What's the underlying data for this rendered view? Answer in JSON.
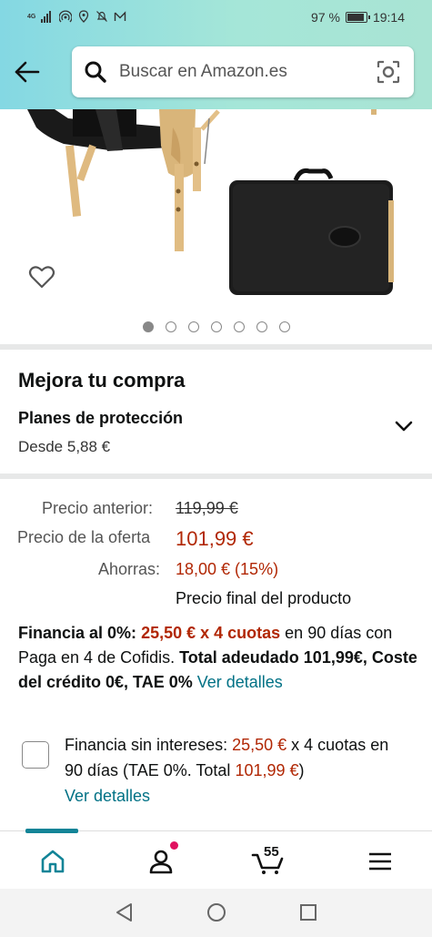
{
  "status_bar": {
    "network": "4G",
    "battery": "97 %",
    "time": "19:14"
  },
  "header": {
    "search_placeholder": "Buscar en Amazon.es"
  },
  "gallery": {
    "dot_count": 7,
    "active_index": 0
  },
  "upgrade": {
    "title": "Mejora tu compra",
    "plan_title": "Planes de protección",
    "plan_price": "Desde 5,88 €"
  },
  "pricing": {
    "previous_label": "Precio anterior:",
    "previous_value": "119,99 €",
    "deal_label": "Precio de la oferta",
    "deal_value": "101,99 €",
    "savings_label": "Ahorras:",
    "savings_value": "18,00 € (15%)",
    "final_note": "Precio final del producto"
  },
  "financing": {
    "lead": "Financia al 0%:",
    "installments": "25,50 € x 4 cuotas",
    "text1": " en 90 días con Paga en 4 de Cofidis. ",
    "bold_total": "Total adeudado 101,99€, Coste del crédito 0€, TAE 0%",
    "link": "Ver detalles"
  },
  "financing_option": {
    "prefix": "Financia sin intereses: ",
    "amount": "25,50 €",
    "middle": " x 4 cuotas en 90 días (TAE 0%. Total ",
    "total": "101,99 €",
    "suffix": ")",
    "link": "Ver detalles"
  },
  "bottom_nav": {
    "cart_count": "55"
  },
  "colors": {
    "accent_teal": "#007185",
    "price_red": "#b12704",
    "header_gradient_start": "#84d8e3",
    "header_gradient_end": "#a9e4d4"
  }
}
